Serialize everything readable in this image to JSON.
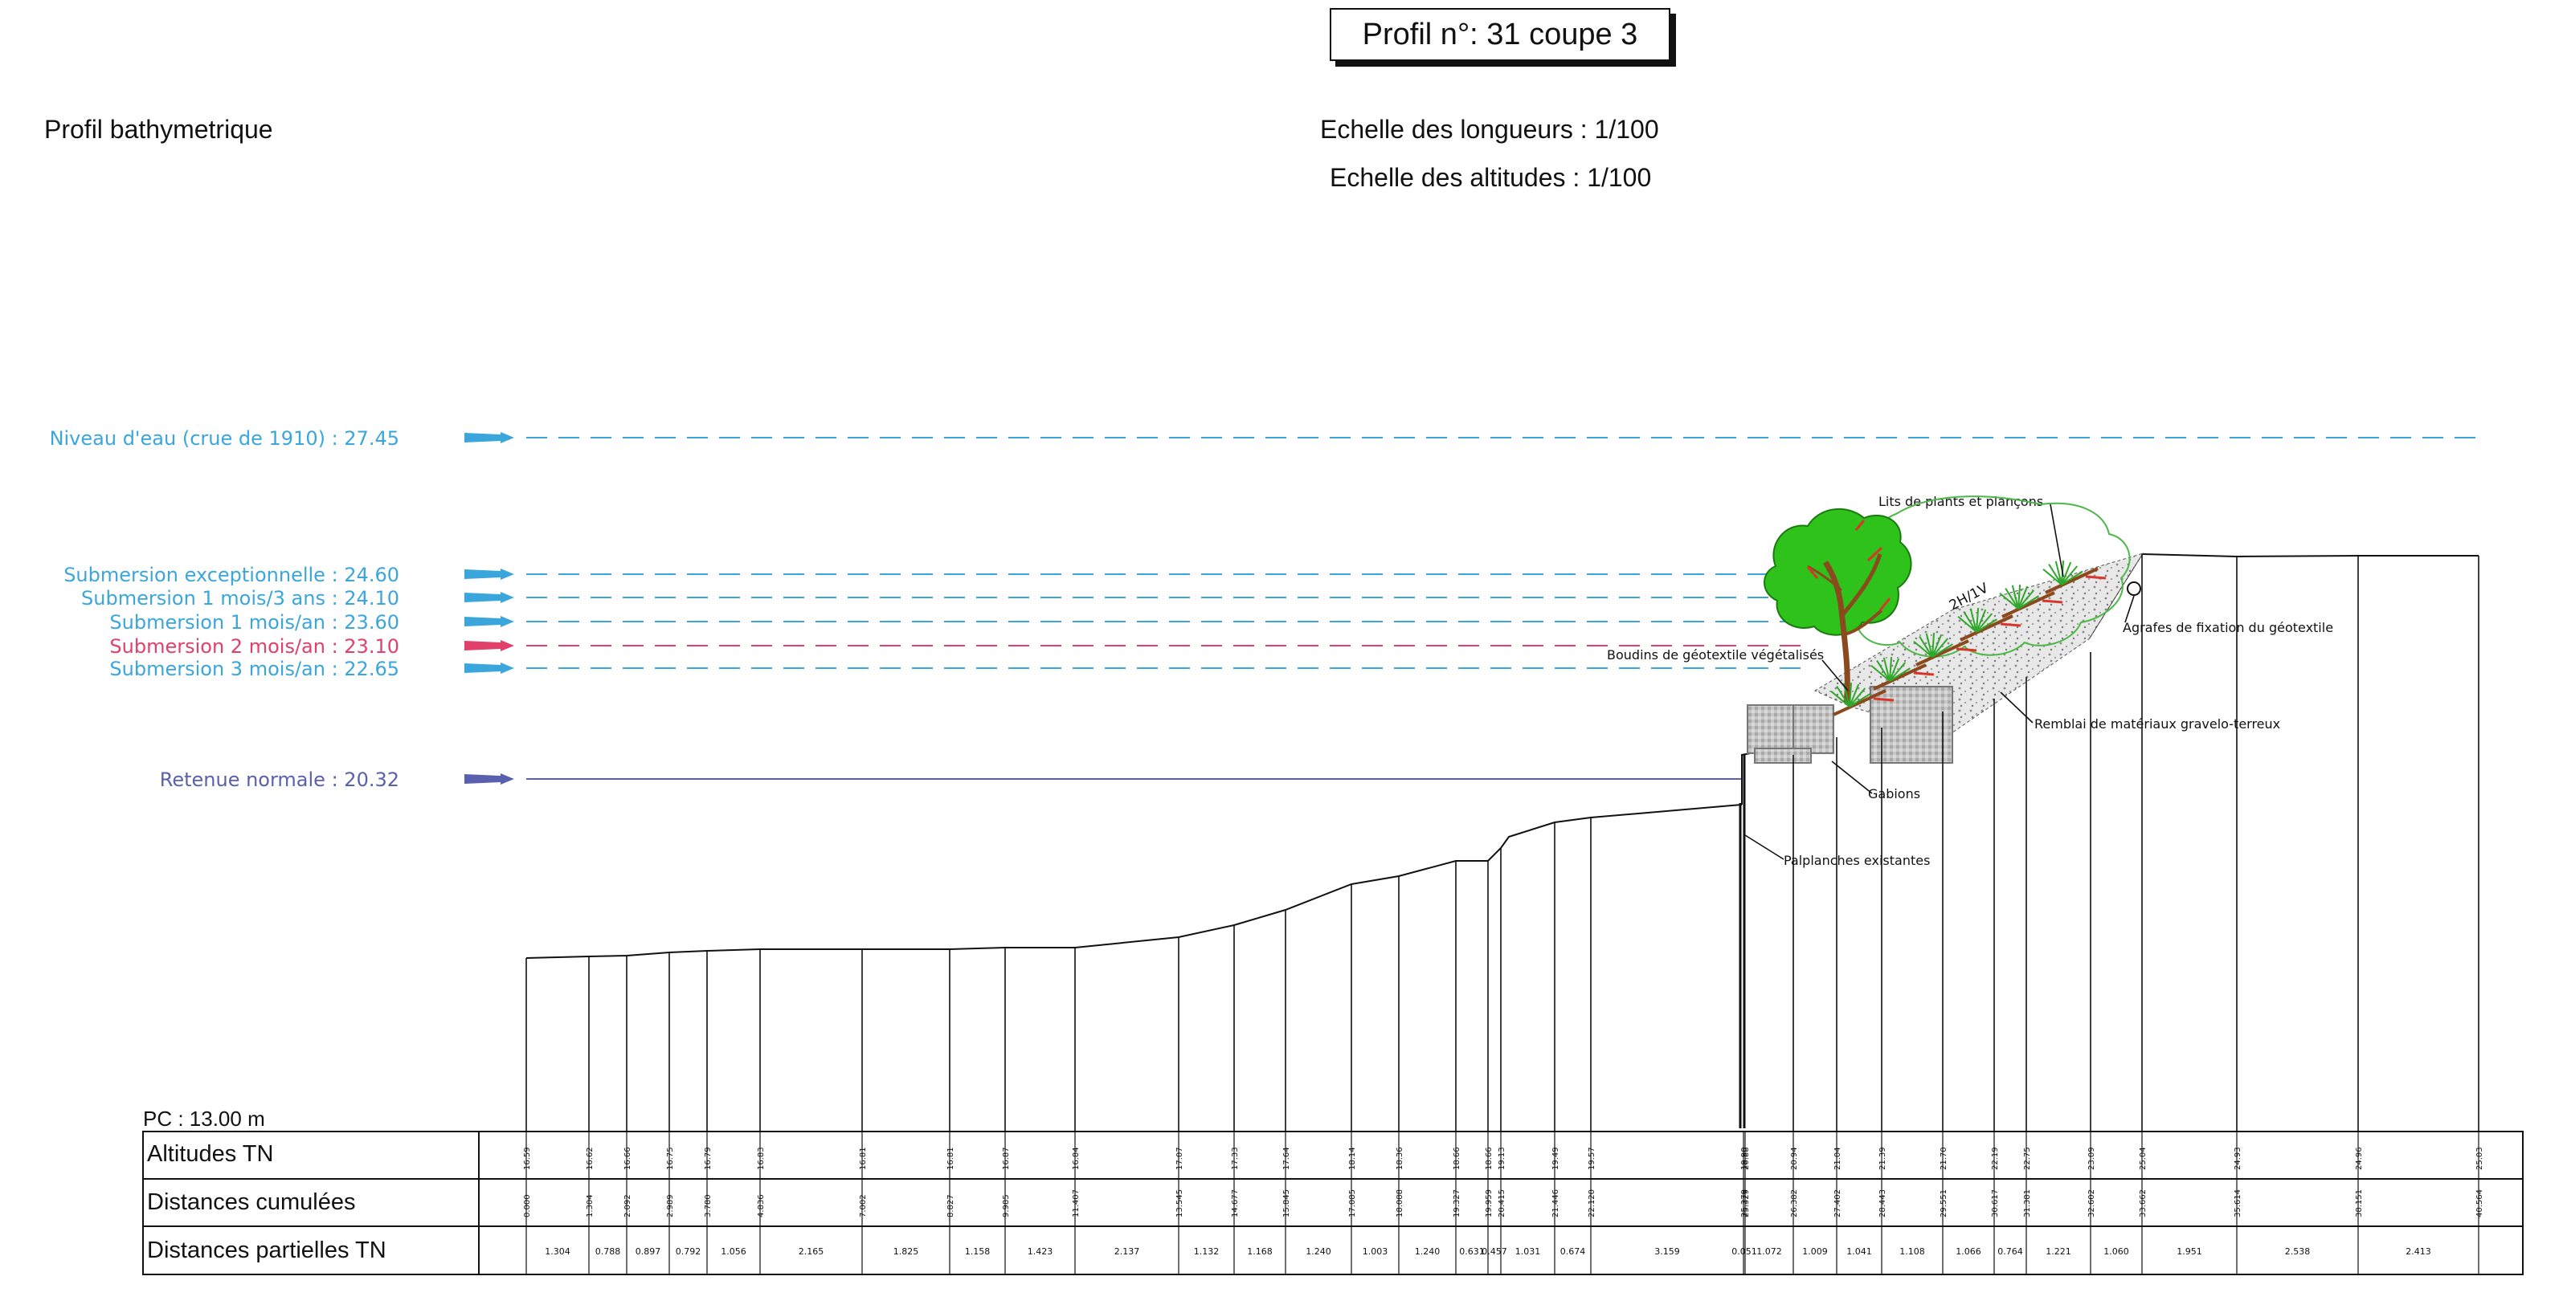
{
  "title": "Profil n°: 31 coupe 3",
  "subtitle": "Profil bathymetrique",
  "scale_lengths": "Echelle des longueurs : 1/100",
  "scale_altitudes": "Echelle des altitudes : 1/100",
  "plane_reference": "PC : 13.00 m",
  "levels": [
    {
      "label": "Niveau d'eau (crue de 1910) : 27.45",
      "color": "#3aa6dc"
    },
    {
      "label": "Submersion exceptionnelle : 24.60",
      "color": "#3aa6dc"
    },
    {
      "label": "Submersion 1 mois/3 ans : 24.10",
      "color": "#3aa6dc"
    },
    {
      "label": "Submersion 1 mois/an : 23.60",
      "color": "#3aa6dc"
    },
    {
      "label": "Submersion 2 mois/an : 23.10",
      "color": "#e0406a"
    },
    {
      "label": "Submersion 3 mois/an : 22.65",
      "color": "#3aa6dc"
    },
    {
      "label": "Retenue normale : 20.32",
      "color": "#5a5fae"
    }
  ],
  "annotations": {
    "plants": "Lits de plants et plançons",
    "slope": "2H/1V",
    "staples": "Agrafes de fixation du géotextile",
    "rolls": "Boudins de géotextile végétalisés",
    "fill": "Remblai de matériaux gravelo-terreux",
    "gabions": "Gabions",
    "sheetpiles": "Palplanches existantes"
  },
  "table": {
    "row_labels": [
      "Altitudes TN",
      "Distances cumulées",
      "Distances partielles TN"
    ],
    "altitudes": [
      "16.59",
      "16.62",
      "16.66",
      "16.75",
      "16.79",
      "16.83",
      "16.81",
      "16.81",
      "16.87",
      "16.84",
      "17.07",
      "17.33",
      "17.64",
      "18.14",
      "18.36",
      "18.66",
      "18.66",
      "19.13",
      "19.49",
      "19.57",
      "19.90",
      "20.88",
      "20.94",
      "21.04",
      "21.39",
      "21.70",
      "22.19",
      "22.75",
      "23.09",
      "25.04",
      "24.93",
      "24.96",
      "25.03"
    ],
    "cumulative": [
      "0.000",
      "1.304",
      "2.092",
      "2.989",
      "3.780",
      "4.836",
      "7.002",
      "8.827",
      "9.985",
      "11.407",
      "13.545",
      "14.677",
      "15.845",
      "17.085",
      "18.088",
      "19.327",
      "19.959",
      "20.415",
      "21.446",
      "22.120",
      "25.279",
      "25.329",
      "26.382",
      "27.402",
      "28.443",
      "29.551",
      "30.617",
      "31.381",
      "32.602",
      "33.662",
      "35.614",
      "38.151",
      "40.564"
    ],
    "partial": [
      "1.304",
      "0.788",
      "0.897",
      "0.792",
      "1.056",
      "2.165",
      "1.825",
      "1.158",
      "1.423",
      "2.137",
      "1.132",
      "1.168",
      "1.240",
      "1.003",
      "1.240",
      "0.631",
      "0.457",
      "1.031",
      "0.674",
      "3.159",
      "0.051",
      "1.072",
      "1.009",
      "1.041",
      "1.108",
      "1.066",
      "0.764",
      "1.221",
      "1.060",
      "1.951",
      "2.538",
      "2.413"
    ]
  },
  "colors": {
    "ink": "#111111",
    "water": "#3aa6dc",
    "pink": "#e0406a",
    "retention": "#5a5fae",
    "tree_green": "#2ec21a",
    "trunk": "#8a4a1e",
    "staple": "#d9352b",
    "gravel": "#cfcfcf",
    "gabion": "#b9b9b9",
    "foliage_outline": "#4cb848"
  },
  "icons": [
    "arrow-right-icon",
    "tree-icon",
    "plant-cutting-icon"
  ]
}
